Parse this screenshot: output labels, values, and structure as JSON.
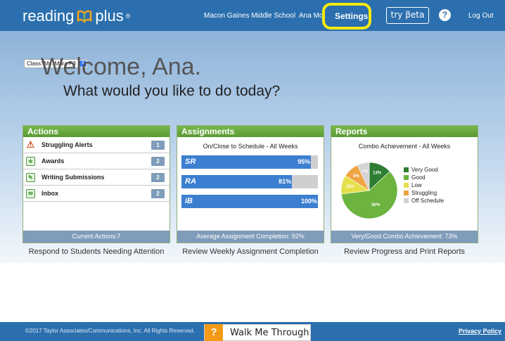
{
  "header": {
    "logo_left": "reading",
    "logo_right": "plus",
    "logo_mark": "®",
    "school": "Macon Gaines Middle School",
    "user": "Ana Mora",
    "settings": "Settings",
    "beta": "try βeta",
    "help": "?",
    "logout": "Log Out"
  },
  "class_select": {
    "value": "Class: Ms. Mora P3"
  },
  "welcome": "Welcome, Ana.",
  "prompt": "What would you like to do today?",
  "actions": {
    "title": "Actions",
    "items": [
      {
        "label": "Struggling Alerts",
        "count": "1",
        "icon": "warning-icon"
      },
      {
        "label": "Awards",
        "count": "2",
        "icon": "award-icon"
      },
      {
        "label": "Writing Submissions",
        "count": "2",
        "icon": "pencil-icon"
      },
      {
        "label": "Inbox",
        "count": "2",
        "icon": "inbox-icon"
      }
    ],
    "footer": "Current Actions:7",
    "caption": "Respond to Students Needing Attention"
  },
  "assignments": {
    "title": "Assignments",
    "subtitle": "On/Close to Schedule - All Weeks",
    "bars": [
      {
        "label": "SR",
        "value": 95,
        "text": "95%"
      },
      {
        "label": "RA",
        "value": 81,
        "text": "81%"
      },
      {
        "label": "iB",
        "value": 100,
        "text": "100%"
      }
    ],
    "footer": "Average Assignment Completion: 92%",
    "caption": "Review Weekly Assignment Completion"
  },
  "reports": {
    "title": "Reports",
    "subtitle": "Combo Achievement - All Weeks",
    "footer": "Very/Good Combo Achievement: 73%",
    "caption": "Review Progress and Print Reports"
  },
  "chart_data": {
    "type": "pie",
    "title": "Combo Achievement - All Weeks",
    "categories": [
      "Very Good",
      "Good",
      "Low",
      "Struggling",
      "Off Schedule"
    ],
    "values": [
      13,
      60,
      11,
      9,
      7
    ],
    "labels": [
      "13%",
      "60%",
      "11%",
      "9%",
      "7%"
    ],
    "colors": [
      "#2e7d32",
      "#6cb33f",
      "#e5df4c",
      "#f0a443",
      "#d4d4d4"
    ],
    "legend": "right"
  },
  "footer": {
    "copyright": "©2017 Taylor Associates/Communications, Inc. All Rights Reserved.",
    "walk_icon": "?",
    "walk_label": "Walk Me Through",
    "privacy": "Privacy Policy"
  }
}
